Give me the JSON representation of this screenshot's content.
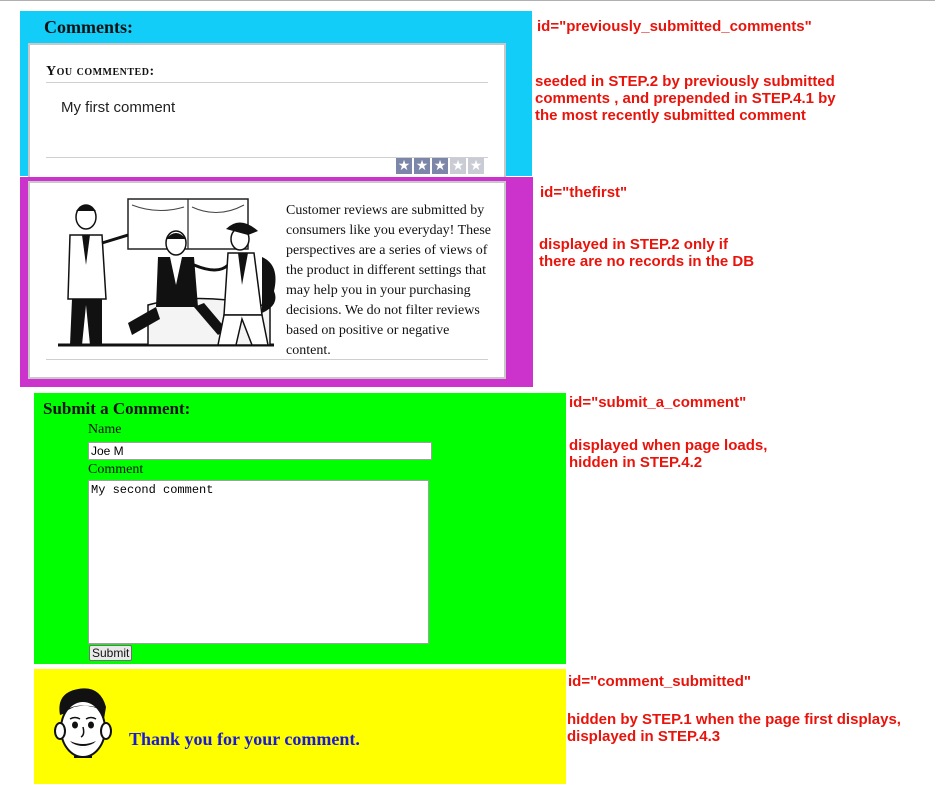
{
  "comments_panel": {
    "title": "Comments:",
    "you_commented": "You commented:",
    "comment_text": "My first comment",
    "rating": {
      "value": 3,
      "max": 5,
      "icon": "star-icon"
    }
  },
  "intro_panel": {
    "text": "Customer reviews are submitted by consumers like you everyday! These perspectives are a series of views of the product in different settings that may help you in your purchasing decisions. We do not filter reviews based on positive or negative content."
  },
  "submit_panel": {
    "title": "Submit a Comment:",
    "name_label": "Name",
    "name_value": "Joe M",
    "comment_label": "Comment",
    "comment_value": "My second comment",
    "submit_label": "Submit"
  },
  "submitted_panel": {
    "thanks": "Thank you for your comment."
  },
  "annotations": {
    "a1": {
      "id": "id=\"previously_submitted_comments\"",
      "lines": [
        "seeded in STEP.2 by previously submitted",
        "comments , and prepended in  STEP.4.1 by",
        "the most recently submitted comment"
      ]
    },
    "a2": {
      "id": "id=\"thefirst\"",
      "lines": [
        "displayed in STEP.2 only if",
        "there are no records in the DB"
      ]
    },
    "a3": {
      "id": "id=\"submit_a_comment\"",
      "lines": [
        "displayed when page loads,",
        "hidden in STEP.4.2"
      ]
    },
    "a4": {
      "id": "id=\"comment_submitted\"",
      "lines": [
        "hidden by STEP.1 when the page first displays,",
        "displayed in STEP.4.3"
      ]
    }
  },
  "colors": {
    "comments_bg": "#11cdf8",
    "intro_bg": "#cc33cc",
    "submit_bg": "#00ff00",
    "submitted_bg": "#ffff00",
    "annotation": "#e8140c",
    "thanks_text": "#1a1ad6"
  }
}
